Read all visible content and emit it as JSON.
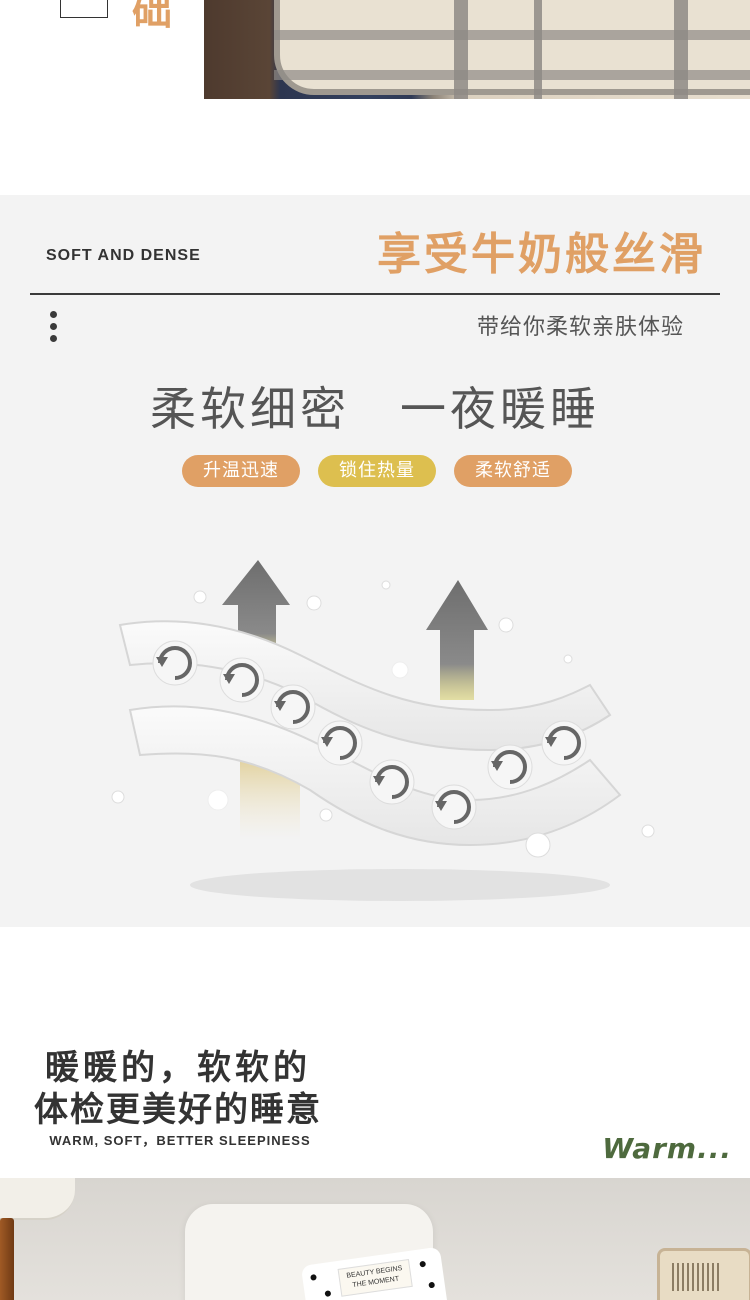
{
  "top": {
    "box_text": "",
    "char": "础"
  },
  "feature": {
    "english_label": "SOFT AND DENSE",
    "title": "享受牛奶般丝滑",
    "subtitle": "带给你柔软亲肤体验",
    "headline": "柔软细密　一夜暖睡",
    "tags": [
      "升温迅速",
      "锁住热量",
      "柔软舒适"
    ],
    "illustration": "soft-dense-fabric-layers-with-heat-arrows"
  },
  "warm": {
    "title_line1": "暖暖的，软软的",
    "title_line2": "体检更美好的睡意",
    "english": "WARM, SOFT，BETTER SLEEPINESS",
    "script": "Warm..."
  },
  "bottom_photo": {
    "pillow_text": "BEAUTY BEGINS THE MOMENT"
  },
  "colors": {
    "accent_orange": "#e0a065",
    "accent_yellow": "#ddbf4f",
    "script_green": "#4e6a3e",
    "text_dark": "#333333"
  }
}
